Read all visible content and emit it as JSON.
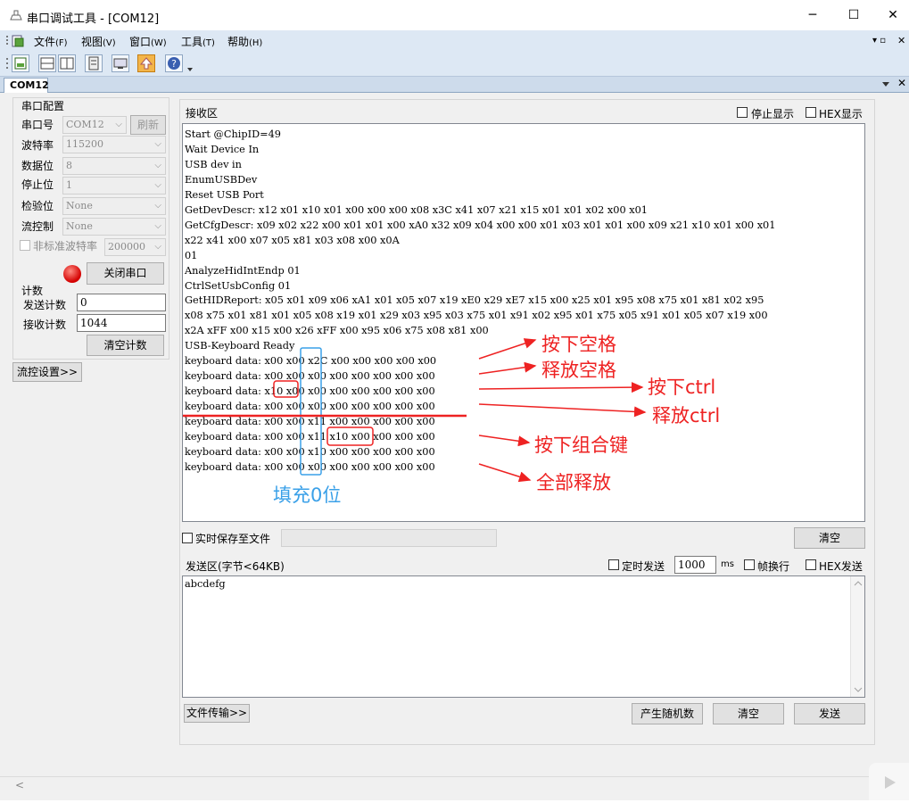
{
  "window": {
    "title": "串口调试工具 - [COM12]",
    "minimize": "─",
    "maximize": "☐",
    "close": "✕"
  },
  "menu": [
    {
      "label": "文件",
      "key": "(F)"
    },
    {
      "label": "视图",
      "key": "(V)"
    },
    {
      "label": "窗口",
      "key": "(W)"
    },
    {
      "label": "工具",
      "key": "(T)"
    },
    {
      "label": "帮助",
      "key": "(H)"
    }
  ],
  "mdi_controls": {
    "restore": "▾ ▫",
    "close": "✕"
  },
  "tab": {
    "label": "COM12"
  },
  "serial_config": {
    "group_title": "串口配置",
    "port_label": "串口号",
    "port_value": "COM12",
    "refresh_button": "刷新",
    "baud_label": "波特率",
    "baud_value": "115200",
    "databits_label": "数据位",
    "databits_value": "8",
    "stopbits_label": "停止位",
    "stopbits_value": "1",
    "parity_label": "检验位",
    "parity_value": "None",
    "flow_label": "流控制",
    "flow_value": "None",
    "nonstd_label": "非标准波特率",
    "nonstd_value": "200000",
    "close_port_button": "关闭串口"
  },
  "counter": {
    "group_title": "计数",
    "sent_label": "发送计数",
    "sent_value": "0",
    "recv_label": "接收计数",
    "recv_value": "1044",
    "clear_button": "清空计数"
  },
  "flow_settings_button": "流控设置>>",
  "receive": {
    "title": "接收区",
    "stop_display_label": "停止显示",
    "hex_display_label": "HEX显示",
    "lines": [
      "Start @ChipID=49",
      "Wait Device In",
      "USB dev in",
      "EnumUSBDev",
      "Reset USB Port",
      "GetDevDescr: x12 x01 x10 x01 x00 x00 x00 x08 x3C x41 x07 x21 x15 x01 x01 x02 x00 x01",
      "GetCfgDescr: x09 x02 x22 x00 x01 x01 x00 xA0 x32 x09 x04 x00 x00 x01 x03 x01 x01 x00 x09 x21 x10 x01 x00 x01",
      "x22 x41 x00 x07 x05 x81 x03 x08 x00 x0A",
      "01",
      "AnalyzeHidIntEndp 01",
      "CtrlSetUsbConfig 01",
      "GetHIDReport: x05 x01 x09 x06 xA1 x01 x05 x07 x19 xE0 x29 xE7 x15 x00 x25 x01 x95 x08 x75 x01 x81 x02 x95",
      "x08 x75 x01 x81 x01 x05 x08 x19 x01 x29 x03 x95 x03 x75 x01 x91 x02 x95 x01 x75 x05 x91 x01 x05 x07 x19 x00",
      "x2A xFF x00 x15 x00 x26 xFF x00 x95 x06 x75 x08 x81 x00",
      "USB-Keyboard Ready",
      "keyboard data: x00 x00 x2C x00 x00 x00 x00 x00",
      "keyboard data: x00 x00 x00 x00 x00 x00 x00 x00",
      "keyboard data: x10 x00 x00 x00 x00 x00 x00 x00",
      "keyboard data: x00 x00 x00 x00 x00 x00 x00 x00",
      "keyboard data: x00 x00 x11 x00 x00 x00 x00 x00",
      "keyboard data: x00 x00 x11 x10 x00 x00 x00 x00",
      "keyboard data: x00 x00 x10 x00 x00 x00 x00 x00",
      "keyboard data: x00 x00 x00 x00 x00 x00 x00 x00"
    ],
    "save_to_file_label": "实时保存至文件",
    "clear_button": "清空"
  },
  "annotations": {
    "press_space": "按下空格",
    "release_space": "释放空格",
    "press_ctrl": "按下ctrl",
    "release_ctrl": "释放ctrl",
    "press_combo": "按下组合键",
    "release_all": "全部释放",
    "fill_zero": "填充0位",
    "arrow_color": "#ee2222",
    "fill_color": "#3aa0e8"
  },
  "send": {
    "title": "发送区(字节<64KB)",
    "timed_send_label": "定时发送",
    "interval_value": "1000",
    "interval_unit": "ms",
    "newline_label": "帧换行",
    "hex_send_label": "HEX发送",
    "content": "abcdefg",
    "file_transfer_button": "文件传输>>",
    "random_button": "产生随机数",
    "clear_button": "清空",
    "send_button": "发送"
  }
}
